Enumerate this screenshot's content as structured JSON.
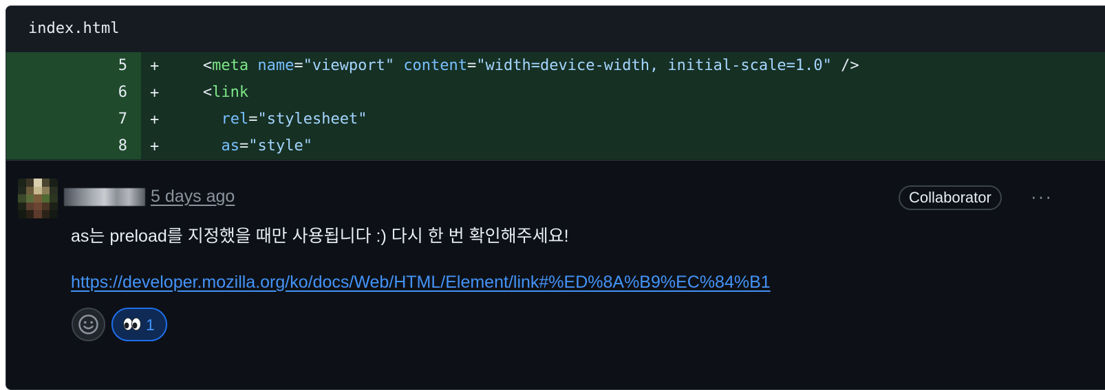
{
  "file": {
    "name": "index.html"
  },
  "diff": {
    "marker": "+",
    "lines": [
      {
        "number": "5",
        "indent": "   ",
        "tokens": [
          {
            "t": "punct",
            "v": "<"
          },
          {
            "t": "tag",
            "v": "meta"
          },
          {
            "t": "punct",
            "v": " "
          },
          {
            "t": "attr",
            "v": "name"
          },
          {
            "t": "punct",
            "v": "="
          },
          {
            "t": "str",
            "v": "\"viewport\""
          },
          {
            "t": "punct",
            "v": " "
          },
          {
            "t": "attr",
            "v": "content"
          },
          {
            "t": "punct",
            "v": "="
          },
          {
            "t": "str",
            "v": "\"width=device-width, initial-scale=1.0\""
          },
          {
            "t": "punct",
            "v": " />"
          }
        ]
      },
      {
        "number": "6",
        "indent": "   ",
        "tokens": [
          {
            "t": "punct",
            "v": "<"
          },
          {
            "t": "tag",
            "v": "link"
          }
        ]
      },
      {
        "number": "7",
        "indent": "     ",
        "tokens": [
          {
            "t": "attr",
            "v": "rel"
          },
          {
            "t": "punct",
            "v": "="
          },
          {
            "t": "str",
            "v": "\"stylesheet\""
          }
        ]
      },
      {
        "number": "8",
        "indent": "     ",
        "tokens": [
          {
            "t": "attr",
            "v": "as"
          },
          {
            "t": "punct",
            "v": "="
          },
          {
            "t": "str",
            "v": "\"style\""
          }
        ]
      }
    ]
  },
  "comment": {
    "timestamp": "5 days ago",
    "role_badge": "Collaborator",
    "more_icon": "···",
    "body": "as는 preload를 지정했을 때만 사용됩니다 :) 다시 한 번 확인해주세요!",
    "link": "https://developer.mozilla.org/ko/docs/Web/HTML/Element/link#%ED%8A%B9%EC%84%B1",
    "reactions": [
      {
        "emoji": "eyes-icon",
        "count": "1"
      }
    ]
  },
  "colors": {
    "background": "#0d1117",
    "added_gutter": "#1f4a2c",
    "added_line": "#163024",
    "link": "#4493f8",
    "tag": "#7ee787",
    "attr": "#79c0ff",
    "string": "#a5d6ff"
  }
}
